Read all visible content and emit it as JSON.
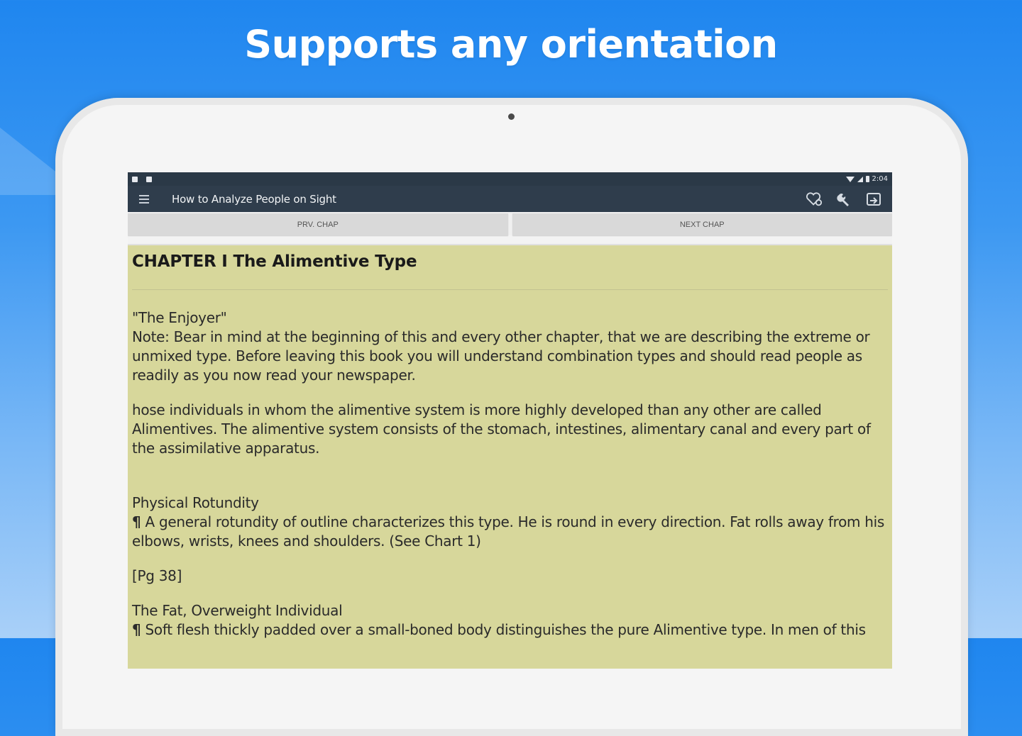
{
  "headline": "Supports any orientation",
  "status_bar": {
    "time": "2:04"
  },
  "toolbar": {
    "title": "How to Analyze People on Sight",
    "icons": [
      "menu-icon",
      "heart-bookmark-icon",
      "wrench-icon",
      "share-icon"
    ]
  },
  "nav": {
    "prev_label": "PRV. CHAP",
    "next_label": "NEXT CHAP"
  },
  "colors": {
    "reader_background": "#d7d79b",
    "toolbar": "#2f3d4c",
    "status_bar": "#2b3947"
  },
  "reader": {
    "chapter_title": "CHAPTER I The Alimentive Type",
    "enjoyer": "\"The Enjoyer\"",
    "note": "Note: Bear in mind at the beginning of this and every other chapter, that we are describing the extreme or unmixed type. Before leaving this book you will understand combination types and should read people as readily as you now read your newspaper.",
    "intro": "hose individuals in whom the alimentive system is more highly developed than any other are called Alimentives. The alimentive system consists of the stomach, intestines, alimentary canal and every part of the assimilative apparatus.",
    "heading1": "Physical Rotundity",
    "pilcrow": "¶",
    "para1": "A general rotundity of outline characterizes this type. He is round in every direction. Fat rolls away from his elbows, wrists, knees and shoulders. (See Chart 1)",
    "page_marker": "[Pg 38]",
    "heading2": "The Fat, Overweight Individual",
    "para2": "Soft flesh thickly padded over a small-boned body distinguishes the pure Alimentive type. In men of this"
  }
}
